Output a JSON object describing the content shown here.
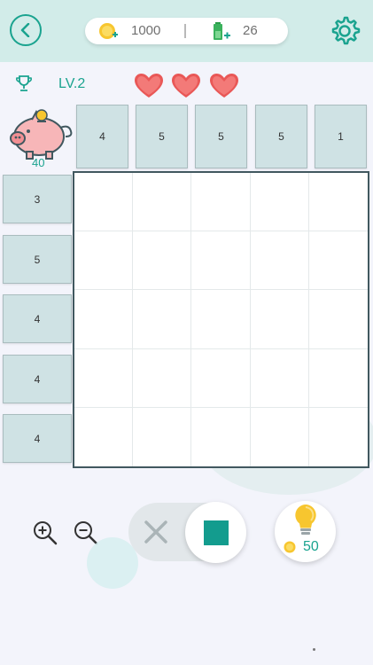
{
  "header": {
    "coins": "1000",
    "energy": "26",
    "accent": "#1aa38f"
  },
  "status": {
    "level": "LV.2",
    "lives": 3,
    "piggy_coins": "40"
  },
  "puzzle": {
    "column_clues": [
      "4",
      "5",
      "5",
      "5",
      "1"
    ],
    "row_clues": [
      "3",
      "5",
      "4",
      "4",
      "4"
    ],
    "grid_size": 5
  },
  "controls": {
    "mode": "fill",
    "hint_cost": "50"
  },
  "icons": [
    "back-arrow-icon",
    "coin-icon",
    "battery-icon",
    "gear-icon",
    "trophy-icon",
    "heart-icon",
    "piggy-bank-icon",
    "zoom-in-icon",
    "zoom-out-icon",
    "x-icon",
    "lightbulb-icon"
  ]
}
